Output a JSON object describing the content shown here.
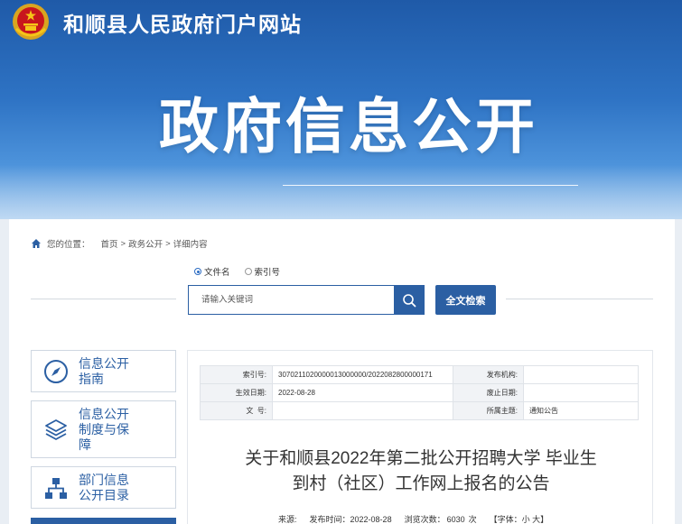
{
  "site": {
    "title": "和顺县人民政府门户网站",
    "hero": "政府信息公开"
  },
  "breadcrumb": {
    "prefix": "您的位置：",
    "items": [
      "首页",
      "政务公开",
      "详细内容"
    ],
    "separator": ">"
  },
  "search": {
    "options": [
      {
        "label": "文件名",
        "selected": true
      },
      {
        "label": "索引号",
        "selected": false
      }
    ],
    "placeholder": "请输入关键词",
    "fulltext_label": "全文检索"
  },
  "sidebar": {
    "items": [
      {
        "label_line1": "信息公开",
        "label_line2": "指南",
        "label_line3": ""
      },
      {
        "label_line1": "信息公开",
        "label_line2": "制度与保",
        "label_line3": "障"
      },
      {
        "label_line1": "部门信息",
        "label_line2": "公开目录",
        "label_line3": ""
      }
    ]
  },
  "meta_table": {
    "index_label": "索引号:",
    "index_value": "3070211020000013000000/2022082800000171",
    "agency_label": "发布机构:",
    "agency_value": "",
    "effective_label": "生效日期:",
    "effective_value": "2022-08-28",
    "expire_label": "废止日期:",
    "expire_value": "",
    "docno_label": "文  号:",
    "docno_value": "",
    "topic_label": "所属主题:",
    "topic_value": "通知公告"
  },
  "article": {
    "title_line1": "关于和顺县2022年第二批公开招聘大学 毕业生",
    "title_line2": "到村（社区）工作网上报名的公告",
    "source_label": "来源:",
    "date_label": "发布时间：",
    "date_value": "2022-08-28",
    "views_label": "浏览次数：",
    "views_value": "6030",
    "views_unit": "次",
    "font_ctl": "【字体：小 大】"
  },
  "colors": {
    "brand": "#2b5fa3",
    "banner_top": "#1f5aa8"
  }
}
